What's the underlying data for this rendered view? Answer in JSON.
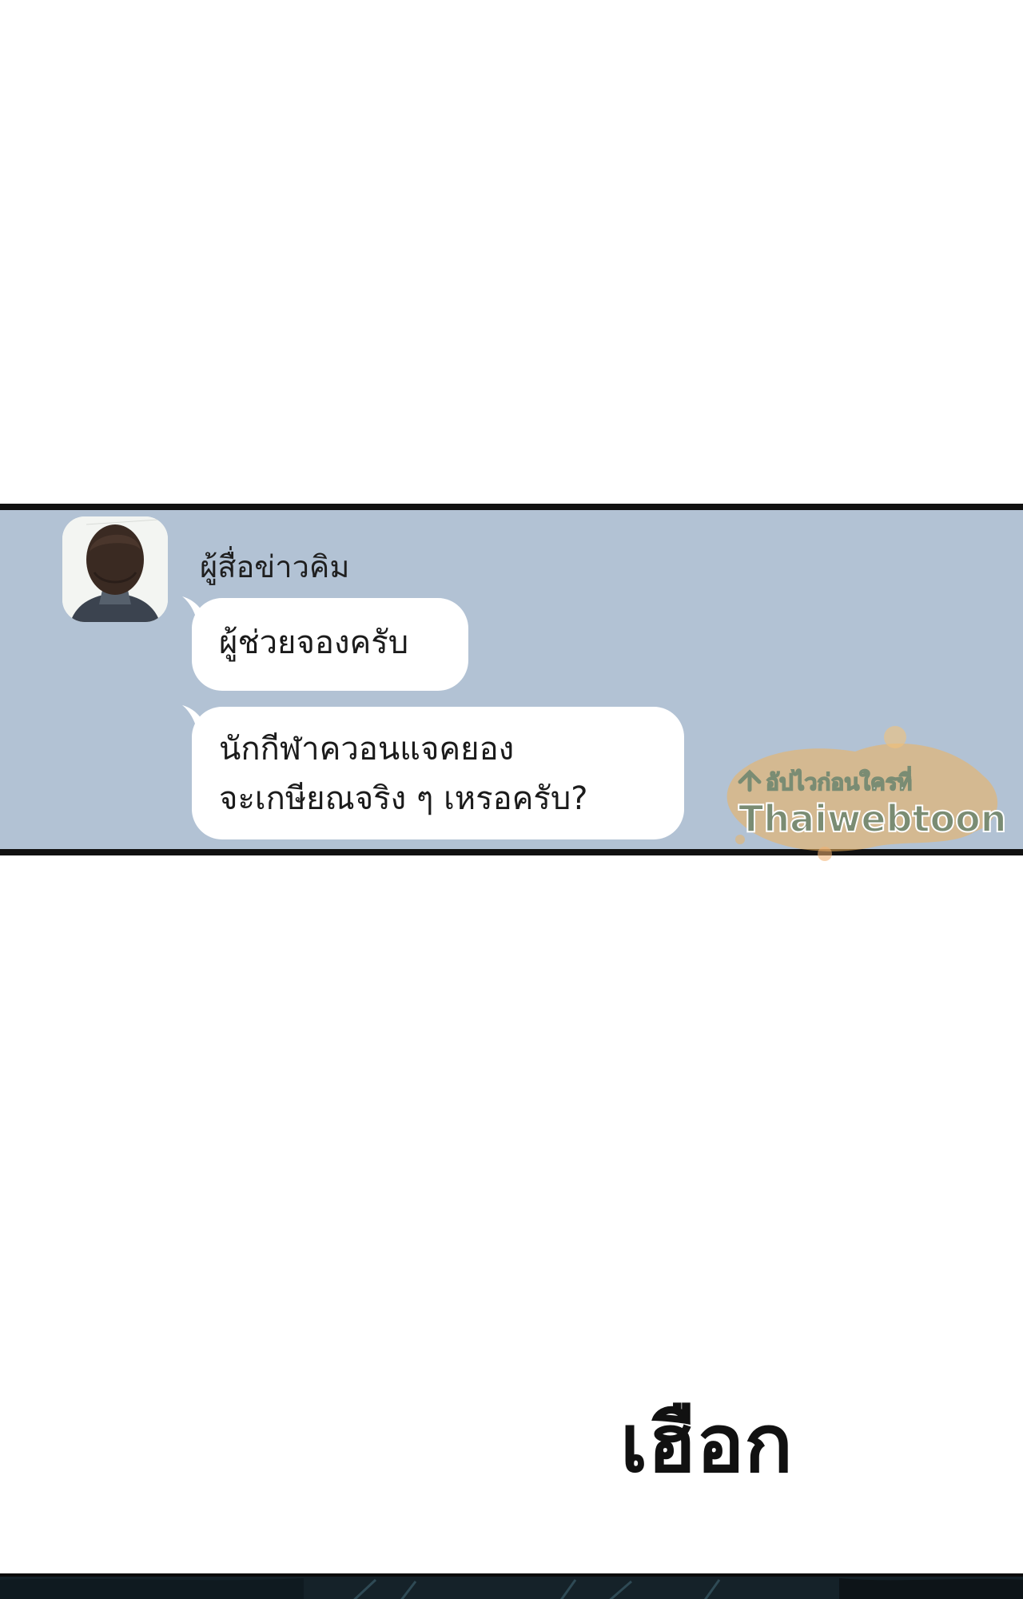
{
  "chat": {
    "sender_name": "ผู้สื่อข่าวคิม",
    "messages": [
      {
        "lines": [
          "ผู้ช่วยจองครับ"
        ]
      },
      {
        "lines": [
          "นักกีฬาควอนแจคยอง",
          "จะเกษียณจริง ๆ เหรอครับ?"
        ]
      }
    ]
  },
  "watermark": {
    "tagline": "อัปไวก่อนใครที่",
    "brand": "Thaiwebtoon"
  },
  "sound_effect": "เฮือก",
  "colors": {
    "page_background": "#ffffff",
    "chat_background": "#b2c2d4",
    "bubble": "#ffffff",
    "panel_border": "#111111",
    "watermark_text": "#7a8c73",
    "watermark_splash": "#f0b25a"
  }
}
